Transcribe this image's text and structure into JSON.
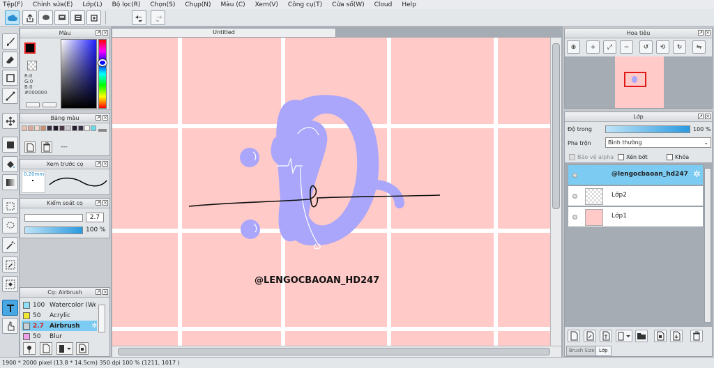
{
  "menu": [
    "Tệp(F)",
    "Chỉnh sửa(E)",
    "Lớp(L)",
    "Bộ lọc(R)",
    "Chọn(S)",
    "Chụp(N)",
    "Màu (C)",
    "Xem(V)",
    "Công cụ(T)",
    "Cửa sổ(W)",
    "Cloud",
    "Help"
  ],
  "document": {
    "tab_title": "Untitled"
  },
  "color_panel": {
    "title": "Màu",
    "r": "R:0",
    "g": "G:0",
    "b": "B:0",
    "hex": "#000000",
    "fg_color": "#000000"
  },
  "swatch_panel": {
    "title": "Bảng màu",
    "dash": "---",
    "colors": [
      "#e8c0b0",
      "#d8a898",
      "#f2d8c8",
      "#c89070",
      "#383040",
      "#201828",
      "#483848",
      "#c8c8cc",
      "#282030",
      "#3c3048",
      "#f4f4f4",
      "#6ad8e8"
    ]
  },
  "brush_preview": {
    "title": "Xem trước cọ",
    "size": "0.20mm"
  },
  "brush_control": {
    "title": "Kiểm soát cọ",
    "size_value": "2.7",
    "opacity_value": "100 %"
  },
  "brush_list": {
    "title": "Cọ: Airbrush",
    "items": [
      {
        "size": "100",
        "name": "Watercolor (Wet)",
        "color": "#8ee0f8"
      },
      {
        "size": "50",
        "name": "Acrylic",
        "color": "#f0e830"
      },
      {
        "size": "2.7",
        "name": "Airbrush",
        "color": "#c8d0d8"
      },
      {
        "size": "50",
        "name": "Blur",
        "color": "#f0a0e8"
      }
    ]
  },
  "navigator": {
    "title": "Hoa tiêu"
  },
  "layer_panel": {
    "title": "Lớp",
    "opacity_label": "Độ trong",
    "opacity_value": "100 %",
    "blend_label": "Pha trộn",
    "blend_value": "Bình thường",
    "protect_alpha": "Bảo vệ alpha",
    "clipping": "Xén bớt",
    "lock": "Khóa",
    "layers": [
      {
        "name": "@lengocbaoan_hd247",
        "selected": true
      },
      {
        "name": "Lớp2",
        "selected": false
      },
      {
        "name": "Lớp1",
        "selected": false
      }
    ],
    "bottom_tabs": [
      "Brush Size",
      "Lớp"
    ]
  },
  "artwork": {
    "watermark": "@LENGOCBAOAN_HD247",
    "bg_color": "#ffcac7",
    "shape_color": "#a9a6fb"
  },
  "status": "1900 * 2000 pixel  (13.8 * 14.5cm)  350 dpi  100 %  (1211, 1017 )"
}
